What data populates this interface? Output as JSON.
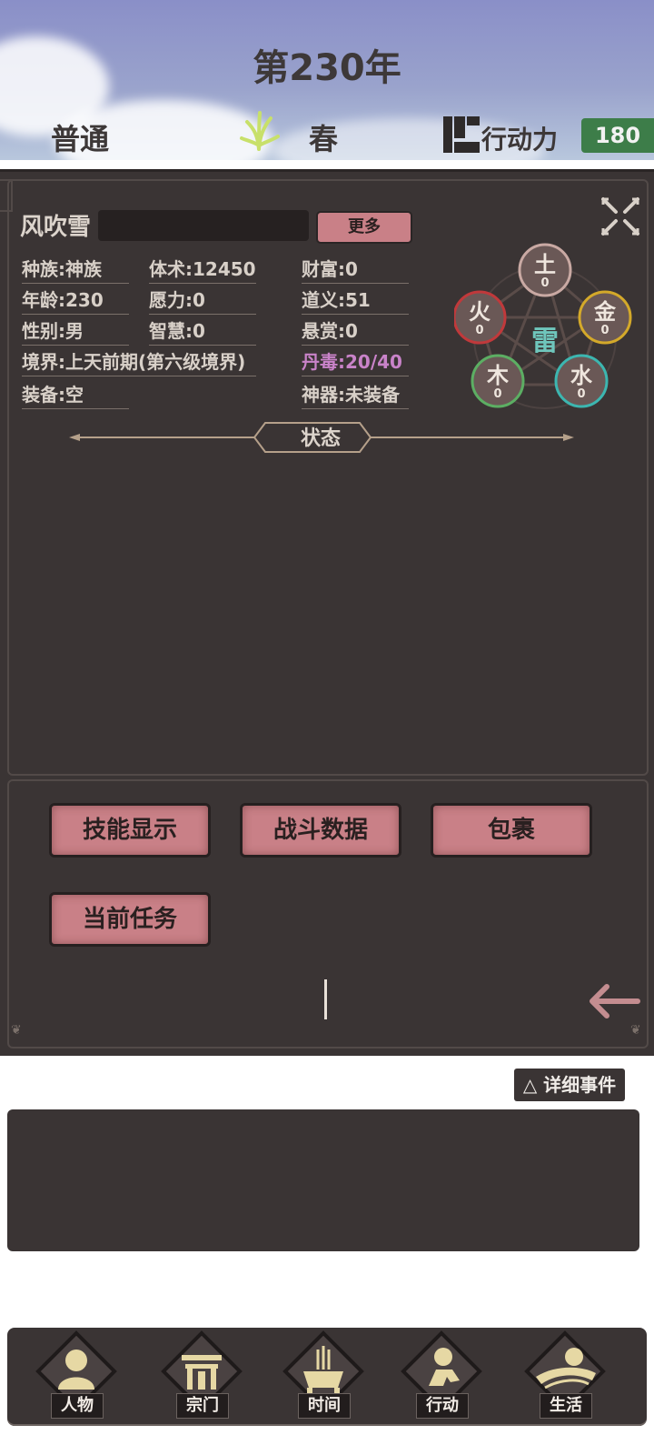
{
  "header": {
    "year": "第230年",
    "mode": "普通",
    "season": "春",
    "action_label": "行动力",
    "action_value": "180"
  },
  "character": {
    "name": "风吹雪",
    "more_button": "更多",
    "stats": {
      "race": "种族:神族",
      "body": "体术:12450",
      "wealth": "财富:0",
      "age": "年龄:230",
      "will": "愿力:0",
      "righteousness": "道义:51",
      "gender": "性别:男",
      "wisdom": "智慧:0",
      "bounty": "悬赏:0",
      "realm": "境界:上天前期(第六级境界)",
      "pill_toxicity": "丹毒:20/40",
      "equipment": "装备:空",
      "artifact": "神器:未装备"
    },
    "elements": {
      "earth": {
        "label": "土",
        "value": "0",
        "color": "#c9a9a3"
      },
      "fire": {
        "label": "火",
        "value": "0",
        "color": "#c0393b"
      },
      "metal": {
        "label": "金",
        "value": "0",
        "color": "#d4a92a"
      },
      "wood": {
        "label": "木",
        "value": "0",
        "color": "#5cae63"
      },
      "water": {
        "label": "水",
        "value": "0",
        "color": "#3cb6b0"
      },
      "center": {
        "label": "雷",
        "color": "#6fc6bc"
      }
    },
    "status_title": "状态"
  },
  "actions": {
    "skills": "技能显示",
    "battle": "战斗数据",
    "bag": "包裹",
    "quest": "当前任务"
  },
  "events": {
    "detail_button": "△ 详细事件"
  },
  "nav": {
    "person": "人物",
    "sect": "宗门",
    "time": "时间",
    "action": "行动",
    "life": "生活"
  },
  "colors": {
    "panel_bg": "#3a3434",
    "button_pink": "#c98087",
    "action_green": "#3d7d49",
    "toxicity_purple": "#c983c9"
  }
}
